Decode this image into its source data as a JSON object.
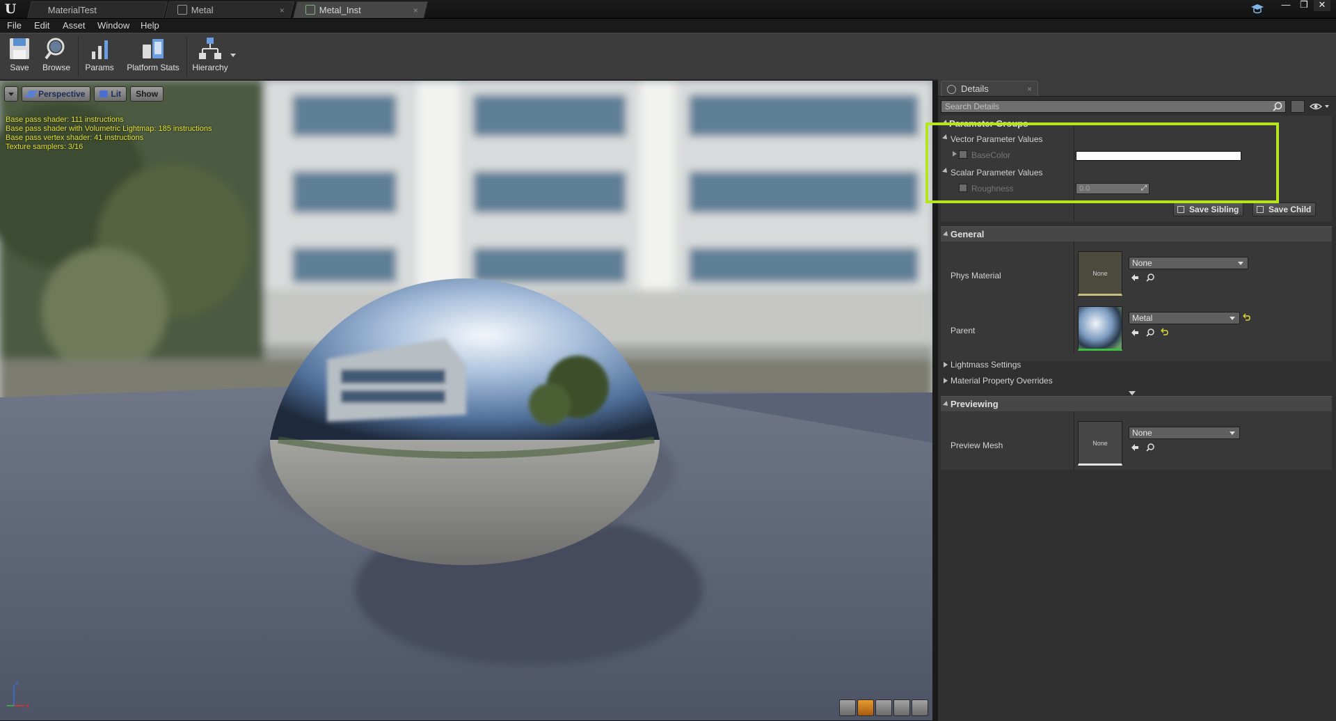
{
  "window": {
    "tabs": [
      {
        "label": "MaterialTest"
      },
      {
        "label": "Metal"
      },
      {
        "label": "Metal_Inst"
      }
    ]
  },
  "menu": [
    "File",
    "Edit",
    "Asset",
    "Window",
    "Help"
  ],
  "toolbar": {
    "save": "Save",
    "browse": "Browse",
    "params": "Params",
    "platform_stats": "Platform Stats",
    "hierarchy": "Hierarchy"
  },
  "viewport": {
    "buttons": {
      "perspective": "Perspective",
      "lit": "Lit",
      "show": "Show"
    },
    "stats": [
      "Base pass shader: 111 instructions",
      "Base pass shader with Volumetric Lightmap: 185 instructions",
      "Base pass vertex shader: 41 instructions",
      "Texture samplers: 3/16"
    ],
    "active_bottom_button": "sphere",
    "icons": [
      "perspective-menu-icon",
      "lit-icon",
      "axis-gizmo",
      "cylinder-icon",
      "sphere-icon",
      "plane-icon",
      "cube-icon",
      "teapot-icon"
    ]
  },
  "details": {
    "tab_label": "Details",
    "search_placeholder": "Search Details",
    "parameter_groups": {
      "header": "Parameter Groups",
      "vector_label": "Vector Parameter Values",
      "base_color_label": "BaseColor",
      "base_color_value": "#ffffff",
      "scalar_label": "Scalar Parameter Values",
      "roughness_label": "Roughness",
      "roughness_value": "0.0"
    },
    "save_sibling": "Save Sibling",
    "save_child": "Save Child",
    "general": {
      "header": "General",
      "phys_material_label": "Phys Material",
      "phys_material_thumb": "None",
      "phys_material_value": "None",
      "parent_label": "Parent",
      "parent_value": "Metal",
      "lightmass_label": "Lightmass Settings",
      "overrides_label": "Material Property Overrides"
    },
    "previewing": {
      "header": "Previewing",
      "preview_mesh_label": "Preview Mesh",
      "preview_mesh_thumb": "None",
      "preview_mesh_value": "None"
    }
  },
  "colors": {
    "highlight": "#b5e61d",
    "stats_text": "#e8e832",
    "active_viewport_button": "#e59a2f"
  }
}
